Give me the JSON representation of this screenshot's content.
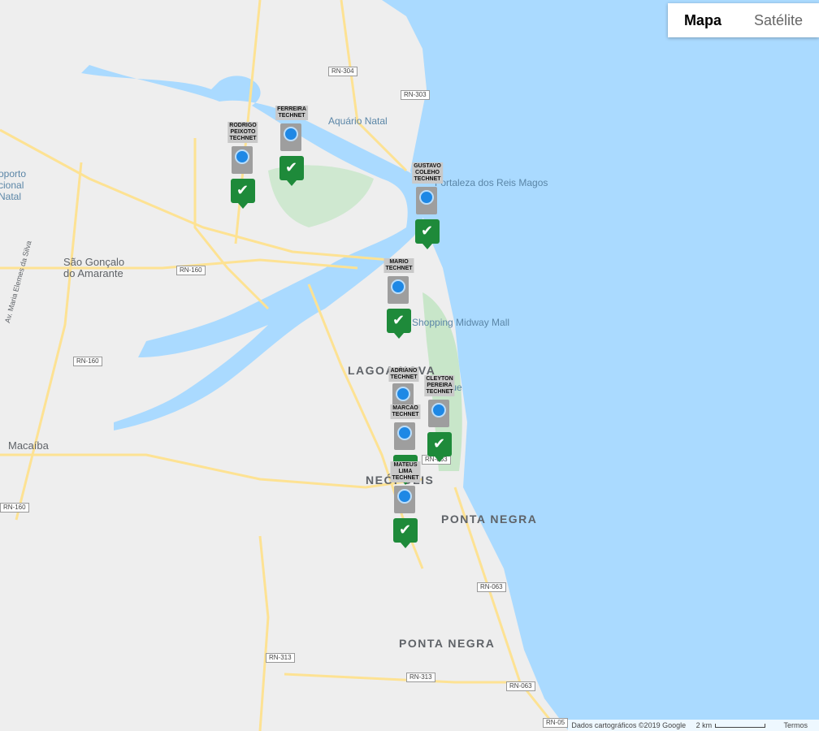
{
  "map_type": {
    "options": [
      "Mapa",
      "Satélite"
    ],
    "selected": "Mapa"
  },
  "labels": {
    "aquario": "Aquário Natal",
    "fortaleza": "Fortaleza dos Reis Magos",
    "aeroporto": "oporto\ncional\nNatal",
    "sao_goncalo": "São Gonçalo\ndo Amarante",
    "midway": "Shopping Midway Mall",
    "lagoa_nova": "LAGOA NOVA",
    "parque": "Parque",
    "macaiba": "Macaíba",
    "neopolis": "NEÓPOLIS",
    "ponta_negra_1": "PONTA NEGRA",
    "ponta_negra_2": "PONTA NEGRA",
    "avenue": "Av. Maria Elemes da Silva"
  },
  "roads": [
    "RN-304",
    "RN-303",
    "RN-160",
    "RN-160",
    "RN-160",
    "RN-063",
    "RN-063",
    "RN-313",
    "RN-313",
    "RN-063",
    "RN-05"
  ],
  "technicians": [
    {
      "name": "RODRIGO PEIXOTO\nTECHNET"
    },
    {
      "name": "FERREIRA\nTECHNET"
    },
    {
      "name": "GUSTAVO\nCOLEHO\nTECHNET"
    },
    {
      "name": "MARIO\nTECHNET"
    },
    {
      "name": "ADRIANO\nTECHNET"
    },
    {
      "name": "CLEYTON PEREIRA\nTECHNET"
    },
    {
      "name": "MARCAO\nTECHNET"
    },
    {
      "name": "MATEUS LIMA\nTECHNET"
    }
  ],
  "footer": {
    "data": "Dados cartográficos ©2019 Google",
    "scale": "2 km",
    "terms": "Termos"
  },
  "colors": {
    "water": "#aadaff",
    "land": "#eeeeee",
    "park": "#c8e6c9",
    "road": "#fde293",
    "marker": "#1e8a3a"
  }
}
